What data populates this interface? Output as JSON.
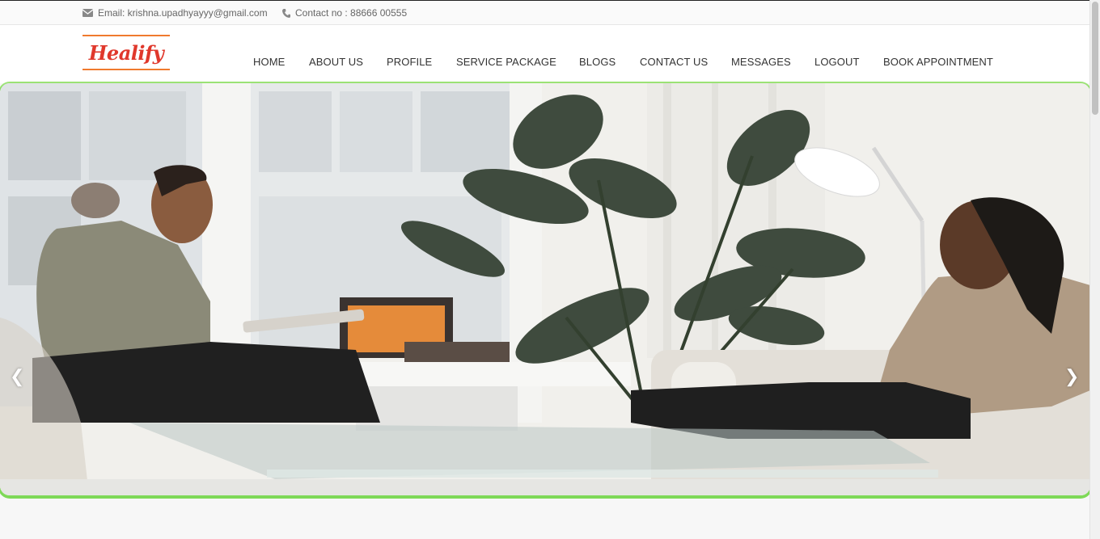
{
  "topbar": {
    "email_text": "Email: krishna.upadhyayyy@gmail.com",
    "email_icon": "envelope-icon",
    "contact_text": "Contact no : 88666 00555",
    "contact_icon": "phone-icon"
  },
  "brand": {
    "logo_text": "Healify",
    "logo_color": "#e0382c",
    "logo_accent": "#f07a2e"
  },
  "nav": {
    "items": [
      {
        "label": "HOME"
      },
      {
        "label": "ABOUT US"
      },
      {
        "label": "PROFILE"
      },
      {
        "label": "SERVICE PACKAGE"
      },
      {
        "label": "BLOGS"
      },
      {
        "label": "CONTACT US"
      },
      {
        "label": "MESSAGES"
      },
      {
        "label": "LOGOUT"
      },
      {
        "label": "BOOK APPOINTMENT"
      }
    ]
  },
  "slider": {
    "prev_symbol": "❮",
    "next_symbol": "❯",
    "border_color": "#7ed957"
  }
}
